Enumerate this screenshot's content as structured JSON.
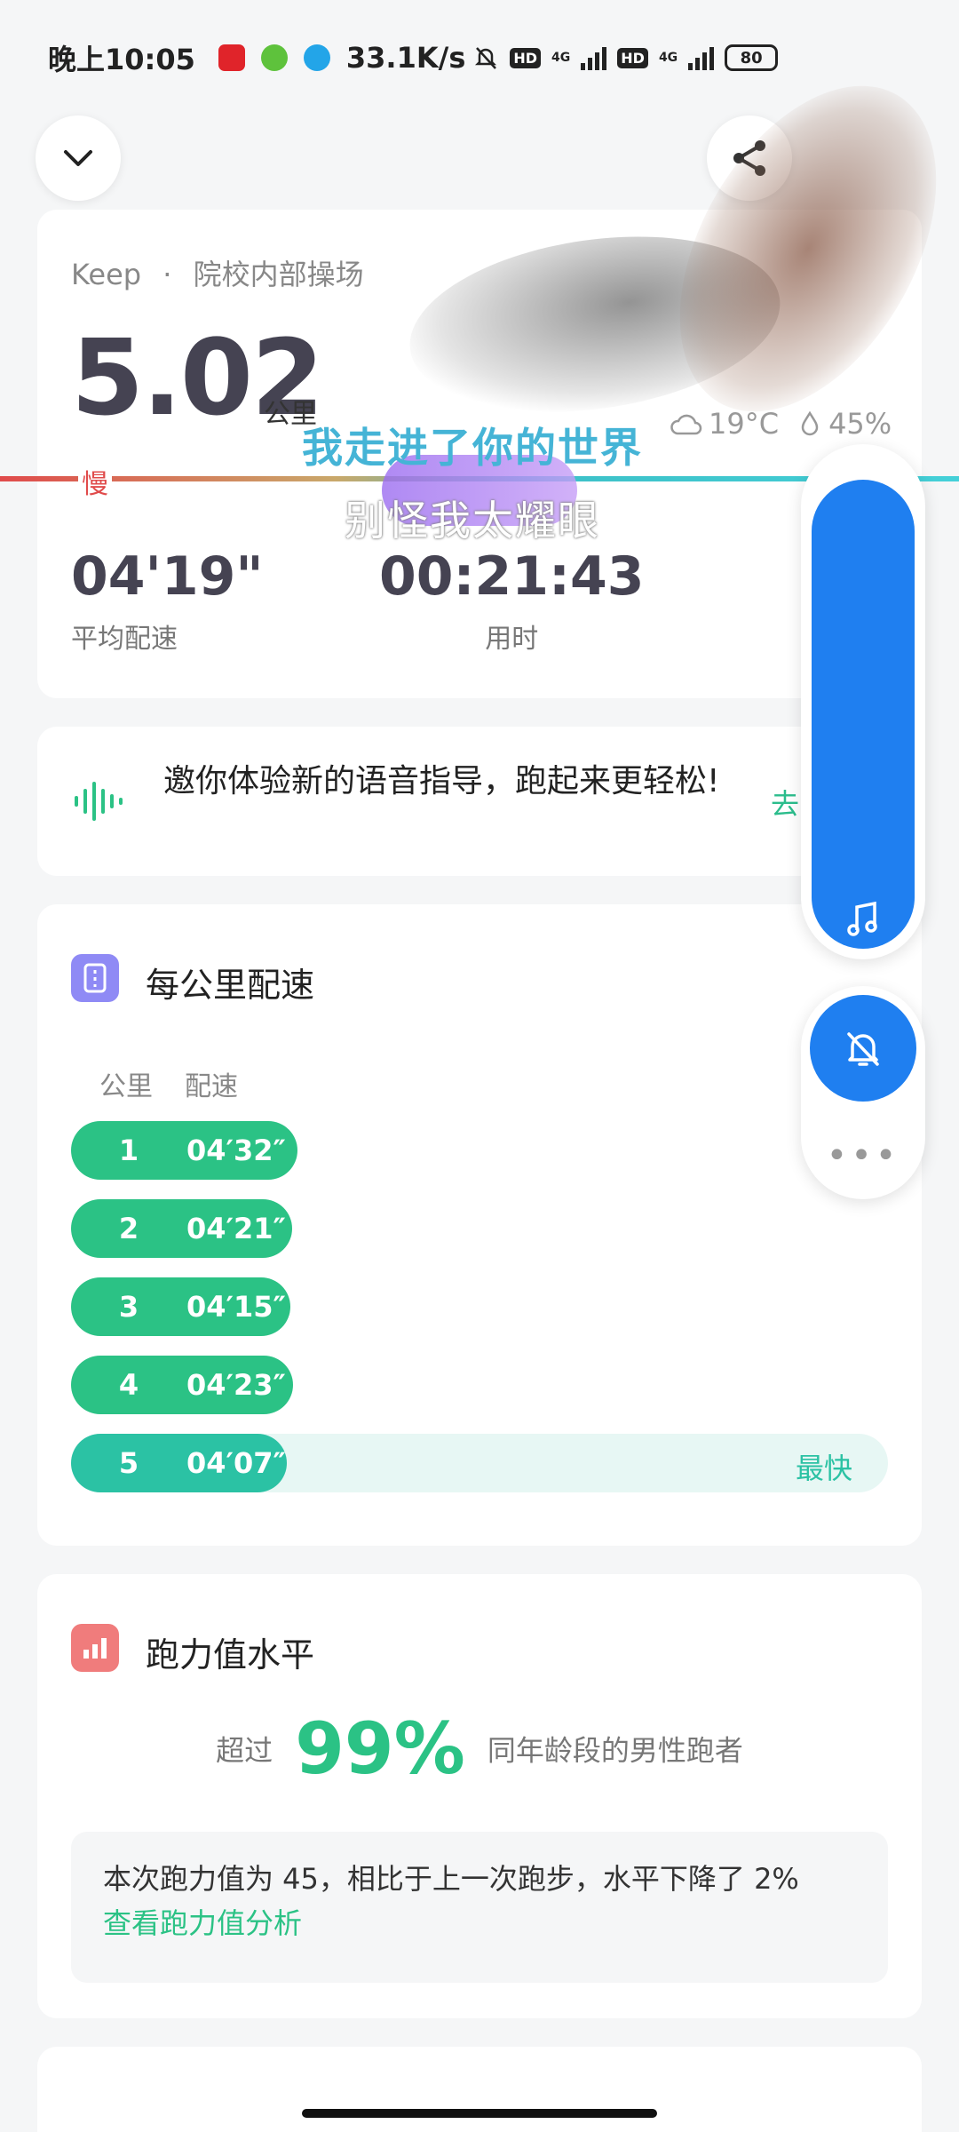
{
  "status_bar": {
    "time": "晚上10:05",
    "net_speed": "33.1K/s",
    "hd1": "HD",
    "hd2": "HD",
    "net1": "4G",
    "net2": "4G",
    "battery": "80"
  },
  "run_summary": {
    "source": "Keep",
    "separator": "·",
    "location": "院校内部操场",
    "distance": "5.02",
    "distance_unit": "公里",
    "temperature": "19°C",
    "humidity": "45%",
    "slow_label": "慢",
    "avg_pace_value": "04'19\"",
    "avg_pace_label": "平均配速",
    "duration_value": "00:21:43",
    "duration_label": "用时"
  },
  "lyrics": {
    "line1": "我走进了你的世界",
    "line2": "别怪我太耀眼"
  },
  "voice_guide": {
    "text": "邀你体验新的语音指导，跑起来更轻松!",
    "action": "去"
  },
  "per_km_pace": {
    "title": "每公里配速",
    "col_km": "公里",
    "col_pace": "配速",
    "fastest_label": "最快",
    "rows": [
      {
        "km": "1",
        "pace": "04′32″",
        "bar_fraction": 0.277
      },
      {
        "km": "2",
        "pace": "04′21″",
        "bar_fraction": 0.271
      },
      {
        "km": "3",
        "pace": "04′15″",
        "bar_fraction": 0.268
      },
      {
        "km": "4",
        "pace": "04′23″",
        "bar_fraction": 0.272
      },
      {
        "km": "5",
        "pace": "04′07″",
        "bar_fraction": 0.264
      }
    ]
  },
  "running_power": {
    "title": "跑力值水平",
    "prefix": "超过",
    "percent": "99%",
    "suffix": "同年龄段的男性跑者",
    "detail": "本次跑力值为 45，相比于上一次跑步，水平下降了 2%",
    "link": "查看跑力值分析"
  },
  "colors": {
    "accent_green": "#2bc285",
    "fastest_teal": "#2bc2a4",
    "music_blue": "#1f7ff0"
  }
}
